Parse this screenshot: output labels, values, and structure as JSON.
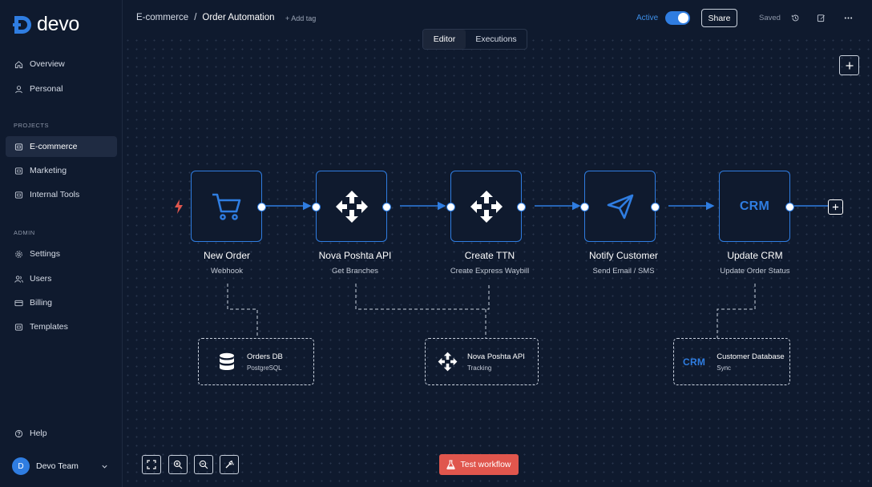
{
  "brand": {
    "name": "devo",
    "accent": "#2f7de1"
  },
  "sidebar": {
    "main_items": [
      {
        "label": "Overview",
        "icon": "home-icon"
      },
      {
        "label": "Personal",
        "icon": "user-icon"
      }
    ],
    "projects_label": "PROJECTS",
    "projects": [
      {
        "label": "E-commerce",
        "icon": "folder-icon",
        "active": true
      },
      {
        "label": "Marketing",
        "icon": "folder-icon"
      },
      {
        "label": "Internal Tools",
        "icon": "folder-icon"
      }
    ],
    "admin_label": "ADMIN",
    "admin_items": [
      {
        "label": "Settings",
        "icon": "gear-icon"
      },
      {
        "label": "Users",
        "icon": "users-icon"
      },
      {
        "label": "Billing",
        "icon": "card-icon"
      },
      {
        "label": "Templates",
        "icon": "template-icon"
      }
    ],
    "help_label": "Help",
    "team": {
      "initial": "D",
      "name": "Devo Team"
    }
  },
  "header": {
    "breadcrumb_parent": "E-commerce",
    "breadcrumb_sep": "/",
    "breadcrumb_current": "Order Automation",
    "add_tag": "+ Add tag",
    "active_label": "Active",
    "active": true,
    "share_label": "Share",
    "saved_label": "Saved"
  },
  "canvas": {
    "tabs": [
      "Editor",
      "Executions"
    ],
    "selected_tab": "Editor",
    "nodes": [
      {
        "title": "New Order",
        "subtitle": "Webhook",
        "icon": "cart-icon"
      },
      {
        "title": "Nova Poshta API",
        "subtitle": "Get Branches",
        "icon": "nova-poshta-icon"
      },
      {
        "title": "Create TTN",
        "subtitle": "Create Express Waybill",
        "icon": "nova-poshta-icon"
      },
      {
        "title": "Notify Customer",
        "subtitle": "Send Email / SMS",
        "icon": "paper-plane-icon"
      },
      {
        "title": "Update CRM",
        "subtitle": "Update Order Status",
        "icon": "crm-icon",
        "icon_text": "CRM"
      }
    ],
    "sub_nodes": [
      {
        "title": "Orders DB",
        "subtitle": "PostgreSQL",
        "icon": "database-icon"
      },
      {
        "title": "Nova Poshta API",
        "subtitle": "Tracking",
        "icon": "nova-poshta-icon"
      },
      {
        "title": "Customer Database",
        "subtitle": "Sync",
        "icon": "crm-icon",
        "icon_text": "CRM"
      }
    ],
    "test_button": "Test workflow",
    "trigger_color": "#e0564d"
  }
}
